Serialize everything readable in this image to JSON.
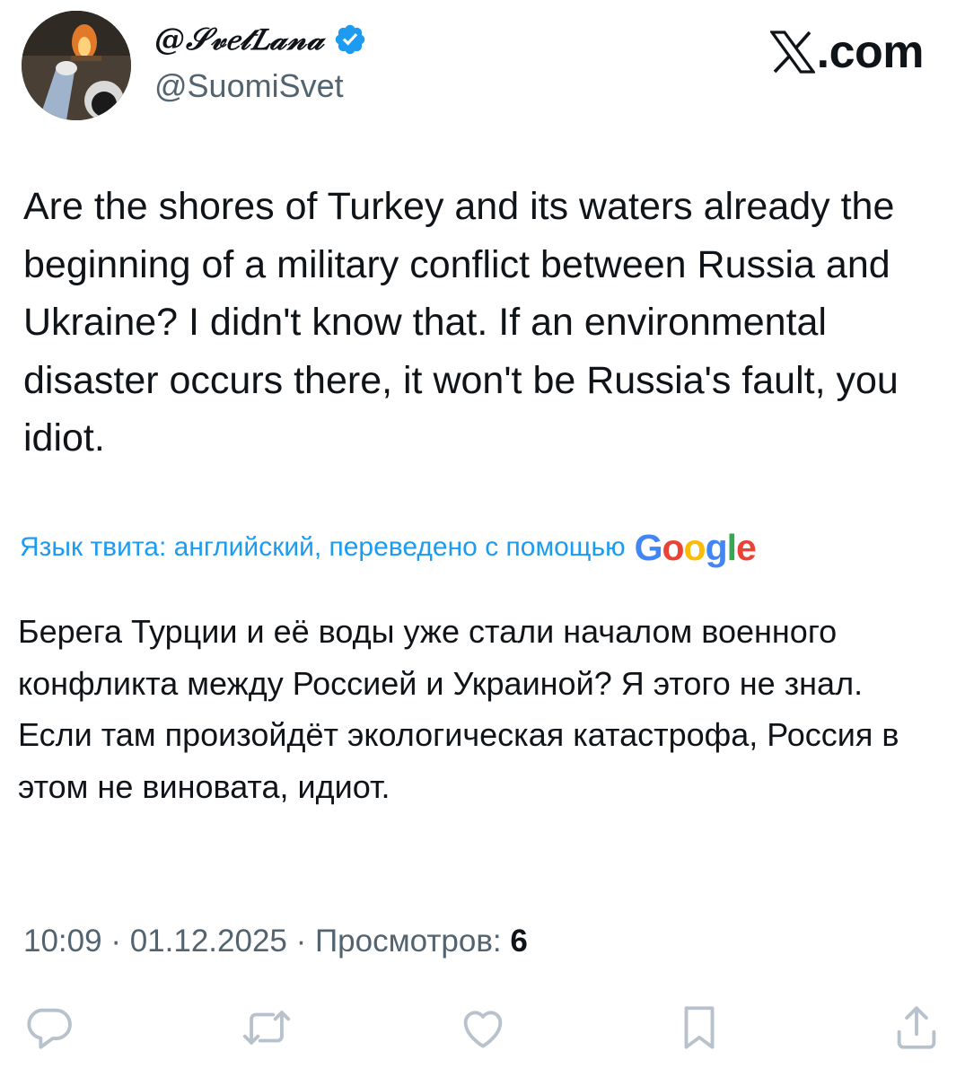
{
  "author": {
    "display_name": "@𝒮𝓋𝑒𝓉𝐿𝒶𝓃𝒶",
    "handle": "@SuomiSvet",
    "verified": true,
    "verified_color": "#1d9bf0"
  },
  "brand": {
    "site_suffix": ".com"
  },
  "tweet": {
    "text": "Are the shores of Turkey and its waters already the beginning of a military conflict between Russia and Ukraine? I didn't know that. If an environmental disaster occurs there, it won't be Russia's fault, you idiot.",
    "translation_note": "Язык твита: английский, переведено с помощью",
    "translation_provider": {
      "letter_1": "G",
      "letter_2": "o",
      "letter_3": "o",
      "letter_4": "g",
      "letter_5": "l",
      "letter_6": "e"
    },
    "translated_text": "Берега Турции и её воды уже стали началом военного конфликта между Россией и Украиной? Я этого не знал. Если там произойдёт экологическая катастрофа, Россия в этом не виновата, идиот.",
    "time": "10:09",
    "date": "01.12.2025",
    "separator": "·",
    "views_label": "Просмотров:",
    "views_count": "6"
  },
  "colors": {
    "link": "#1d9bf0",
    "secondary_text": "#536471",
    "primary_text": "#0f1419",
    "action_icons": "#b8c2cc"
  },
  "icons": {
    "reply": "reply-icon",
    "retweet": "retweet-icon",
    "like": "like-icon",
    "bookmark": "bookmark-icon",
    "share": "share-icon"
  }
}
